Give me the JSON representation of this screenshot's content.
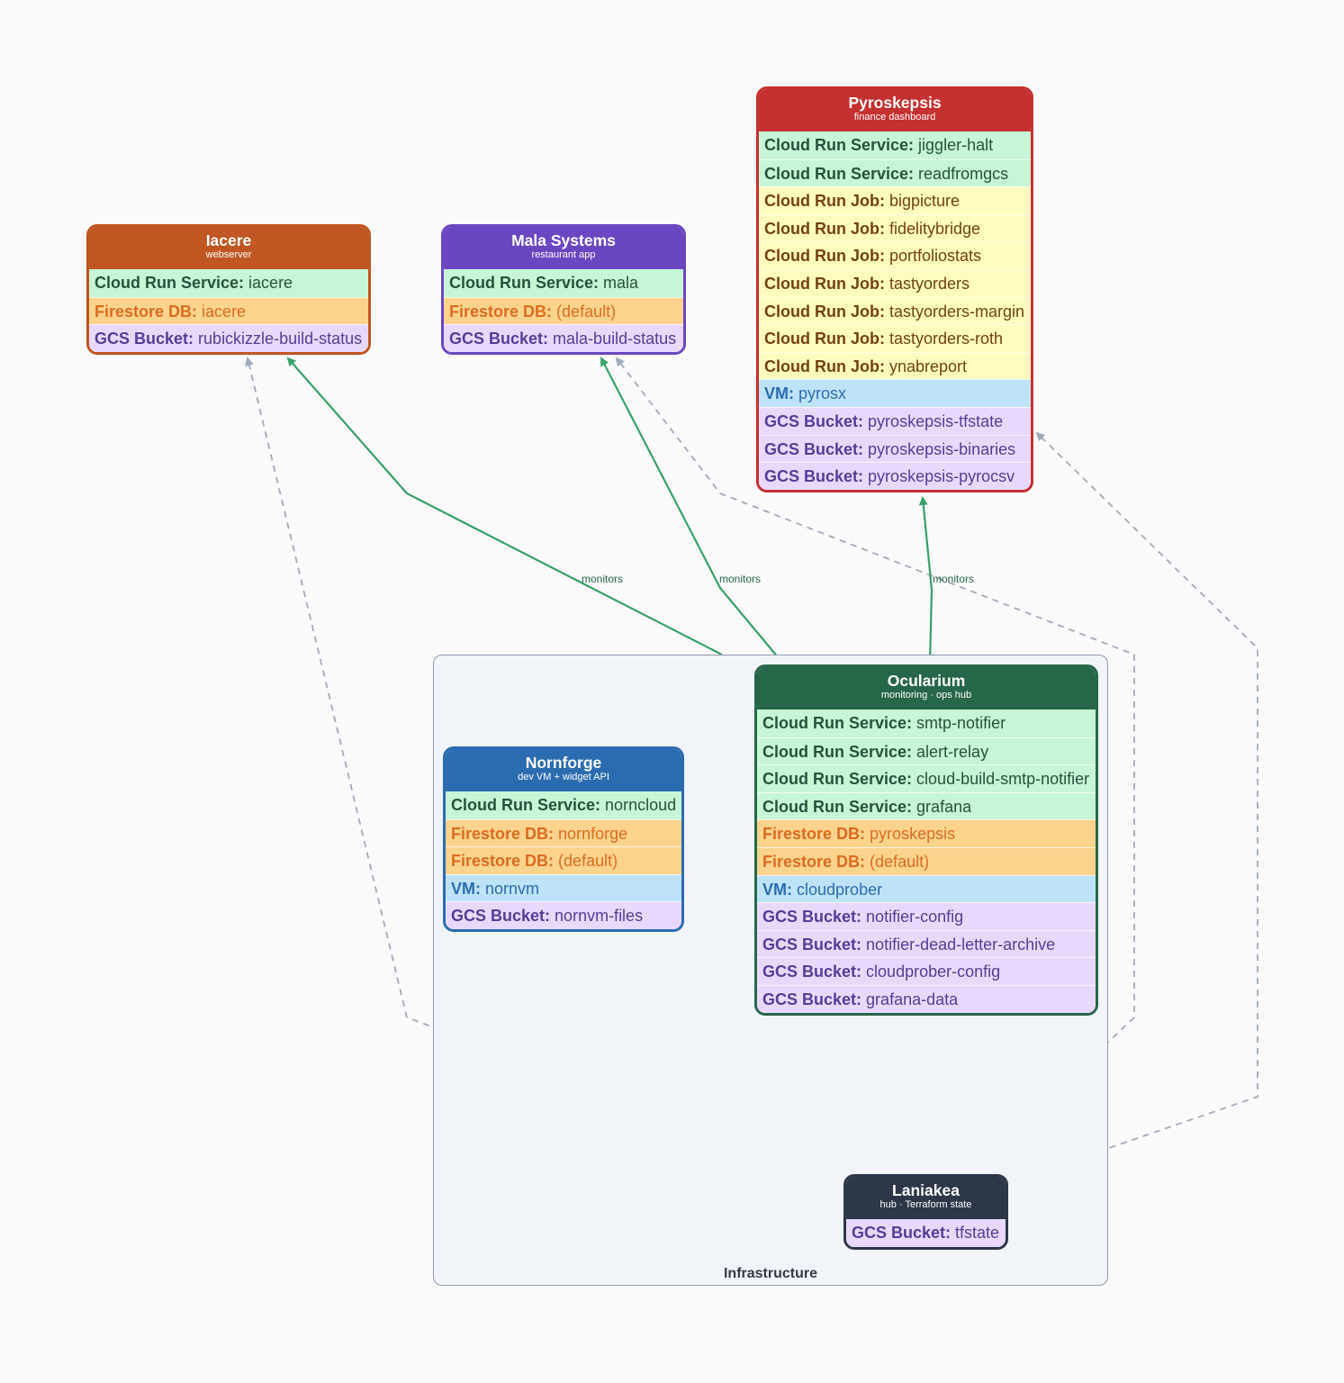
{
  "cluster": {
    "label": "Infrastructure"
  },
  "colors": {
    "monitors_edge": "#38a169",
    "dashed_edge": "#a0aabc",
    "iacere": "#c05621",
    "mala": "#6b46c1",
    "pyroskepsis": "#c53030",
    "ocularium": "#276749",
    "nornforge": "#2b6cb0",
    "laniakea": "#2d3748"
  },
  "nodes": {
    "iacere": {
      "title": "Iacere",
      "subtitle": "webserver",
      "rows": [
        {
          "type": "Cloud Run Service:",
          "name": "iacere",
          "kind": "run-service"
        },
        {
          "type": "Firestore DB:",
          "name": "iacere",
          "kind": "firestore"
        },
        {
          "type": "GCS Bucket:",
          "name": "rubickizzle-build-status",
          "kind": "gcs"
        }
      ]
    },
    "mala": {
      "title": "Mala Systems",
      "subtitle": "restaurant app",
      "rows": [
        {
          "type": "Cloud Run Service:",
          "name": "mala",
          "kind": "run-service"
        },
        {
          "type": "Firestore DB:",
          "name": "(default)",
          "kind": "firestore"
        },
        {
          "type": "GCS Bucket:",
          "name": "mala-build-status",
          "kind": "gcs"
        }
      ]
    },
    "pyroskepsis": {
      "title": "Pyroskepsis",
      "subtitle": "finance dashboard",
      "rows": [
        {
          "type": "Cloud Run Service:",
          "name": "jiggler-halt",
          "kind": "run-service"
        },
        {
          "type": "Cloud Run Service:",
          "name": "readfromgcs",
          "kind": "run-service"
        },
        {
          "type": "Cloud Run Job:",
          "name": "bigpicture",
          "kind": "run-job"
        },
        {
          "type": "Cloud Run Job:",
          "name": "fidelitybridge",
          "kind": "run-job"
        },
        {
          "type": "Cloud Run Job:",
          "name": "portfoliostats",
          "kind": "run-job"
        },
        {
          "type": "Cloud Run Job:",
          "name": "tastyorders",
          "kind": "run-job"
        },
        {
          "type": "Cloud Run Job:",
          "name": "tastyorders-margin",
          "kind": "run-job"
        },
        {
          "type": "Cloud Run Job:",
          "name": "tastyorders-roth",
          "kind": "run-job"
        },
        {
          "type": "Cloud Run Job:",
          "name": "ynabreport",
          "kind": "run-job"
        },
        {
          "type": "VM:",
          "name": "pyrosx",
          "kind": "vm"
        },
        {
          "type": "GCS Bucket:",
          "name": "pyroskepsis-tfstate",
          "kind": "gcs"
        },
        {
          "type": "GCS Bucket:",
          "name": "pyroskepsis-binaries",
          "kind": "gcs"
        },
        {
          "type": "GCS Bucket:",
          "name": "pyroskepsis-pyrocsv",
          "kind": "gcs"
        }
      ]
    },
    "ocularium": {
      "title": "Ocularium",
      "subtitle": "monitoring · ops hub",
      "rows": [
        {
          "type": "Cloud Run Service:",
          "name": "smtp-notifier",
          "kind": "run-service"
        },
        {
          "type": "Cloud Run Service:",
          "name": "alert-relay",
          "kind": "run-service"
        },
        {
          "type": "Cloud Run Service:",
          "name": "cloud-build-smtp-notifier",
          "kind": "run-service"
        },
        {
          "type": "Cloud Run Service:",
          "name": "grafana",
          "kind": "run-service"
        },
        {
          "type": "Firestore DB:",
          "name": "pyroskepsis",
          "kind": "firestore"
        },
        {
          "type": "Firestore DB:",
          "name": "(default)",
          "kind": "firestore"
        },
        {
          "type": "VM:",
          "name": "cloudprober",
          "kind": "vm"
        },
        {
          "type": "GCS Bucket:",
          "name": "notifier-config",
          "kind": "gcs"
        },
        {
          "type": "GCS Bucket:",
          "name": "notifier-dead-letter-archive",
          "kind": "gcs"
        },
        {
          "type": "GCS Bucket:",
          "name": "cloudprober-config",
          "kind": "gcs"
        },
        {
          "type": "GCS Bucket:",
          "name": "grafana-data",
          "kind": "gcs"
        }
      ]
    },
    "nornforge": {
      "title": "Nornforge",
      "subtitle": "dev VM + widget API",
      "rows": [
        {
          "type": "Cloud Run Service:",
          "name": "norncloud",
          "kind": "run-service"
        },
        {
          "type": "Firestore DB:",
          "name": "nornforge",
          "kind": "firestore"
        },
        {
          "type": "Firestore DB:",
          "name": "(default)",
          "kind": "firestore"
        },
        {
          "type": "VM:",
          "name": "nornvm",
          "kind": "vm"
        },
        {
          "type": "GCS Bucket:",
          "name": "nornvm-files",
          "kind": "gcs"
        }
      ]
    },
    "laniakea": {
      "title": "Laniakea",
      "subtitle": "hub · Terraform state",
      "rows": [
        {
          "type": "GCS Bucket:",
          "name": "tfstate",
          "kind": "gcs"
        }
      ]
    }
  },
  "edges": {
    "monitors_label": "monitors",
    "monitors": [
      {
        "from": "ocularium",
        "to": "iacere"
      },
      {
        "from": "ocularium",
        "to": "mala"
      },
      {
        "from": "ocularium",
        "to": "pyroskepsis"
      }
    ],
    "dependencies": [
      {
        "from": "laniakea",
        "to": "iacere"
      },
      {
        "from": "laniakea",
        "to": "mala"
      },
      {
        "from": "laniakea",
        "to": "pyroskepsis"
      },
      {
        "from": "laniakea",
        "to": "ocularium"
      },
      {
        "from": "laniakea",
        "to": "nornforge"
      }
    ]
  }
}
